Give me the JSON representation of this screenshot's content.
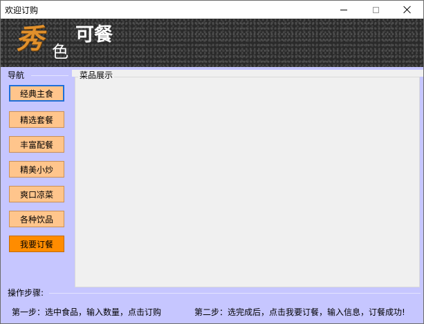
{
  "window": {
    "title": "欢迎订购"
  },
  "banner": {
    "logo_big": "秀",
    "logo_small": "色",
    "logo_text": "可餐"
  },
  "nav": {
    "caption": "导航",
    "items": [
      {
        "label": "经典主食",
        "state": "selected"
      },
      {
        "label": "精选套餐",
        "state": "normal"
      },
      {
        "label": "丰富配餐",
        "state": "normal"
      },
      {
        "label": "精美小炒",
        "state": "normal"
      },
      {
        "label": "爽口凉菜",
        "state": "normal"
      },
      {
        "label": "各种饮品",
        "state": "normal"
      },
      {
        "label": "我要订餐",
        "state": "primary"
      }
    ]
  },
  "dish_display": {
    "caption": "菜品展示"
  },
  "steps": {
    "caption": "操作步骤:",
    "step1": "第一步：选中食品，输入数量，点击订购",
    "step2": "第二步：选完成后，点击我要订餐，输入信息，订餐成功!"
  },
  "colors": {
    "background": "#c6c6ff",
    "nav_button": "#ffc58c",
    "order_button": "#ff8c00",
    "selected_border": "#1e6ed8",
    "logo_orange": "#e0902c"
  },
  "icons": {
    "minimize": "minimize-icon",
    "maximize": "maximize-icon",
    "close": "close-icon"
  }
}
